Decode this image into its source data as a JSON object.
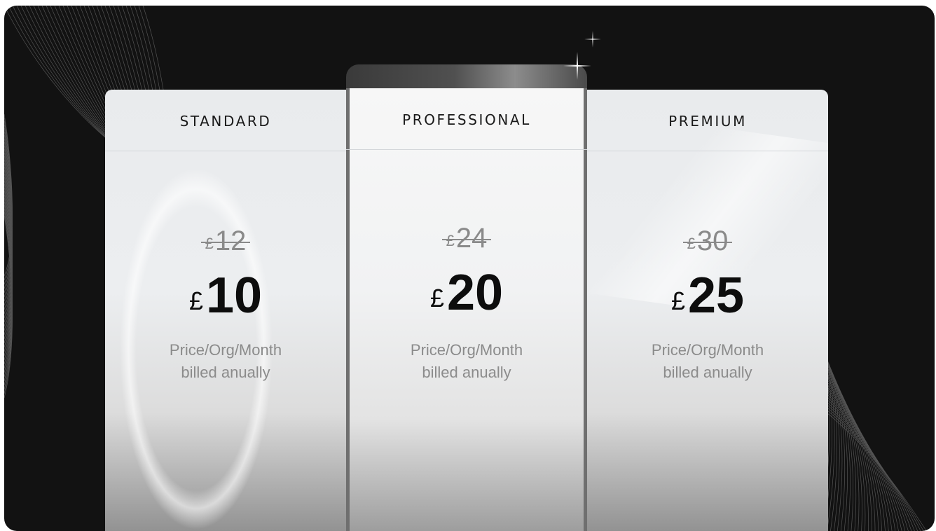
{
  "plans": [
    {
      "name": "STANDARD",
      "old_currency": "£",
      "old_amount": "12",
      "currency": "£",
      "amount": "10",
      "note_line1": "Price/Org/Month",
      "note_line2": "billed anually"
    },
    {
      "name": "PROFESSIONAL",
      "old_currency": "£",
      "old_amount": "24",
      "currency": "£",
      "amount": "20",
      "note_line1": "Price/Org/Month",
      "note_line2": "billed anually"
    },
    {
      "name": "PREMIUM",
      "old_currency": "£",
      "old_amount": "30",
      "currency": "£",
      "amount": "25",
      "note_line1": "Price/Org/Month",
      "note_line2": "billed anually"
    }
  ],
  "highlighted_plan": "PROFESSIONAL",
  "colors": {
    "background": "#121212",
    "card": "#eceef0",
    "text_dark": "#0d0d0d",
    "text_muted": "#8a8a8a"
  }
}
